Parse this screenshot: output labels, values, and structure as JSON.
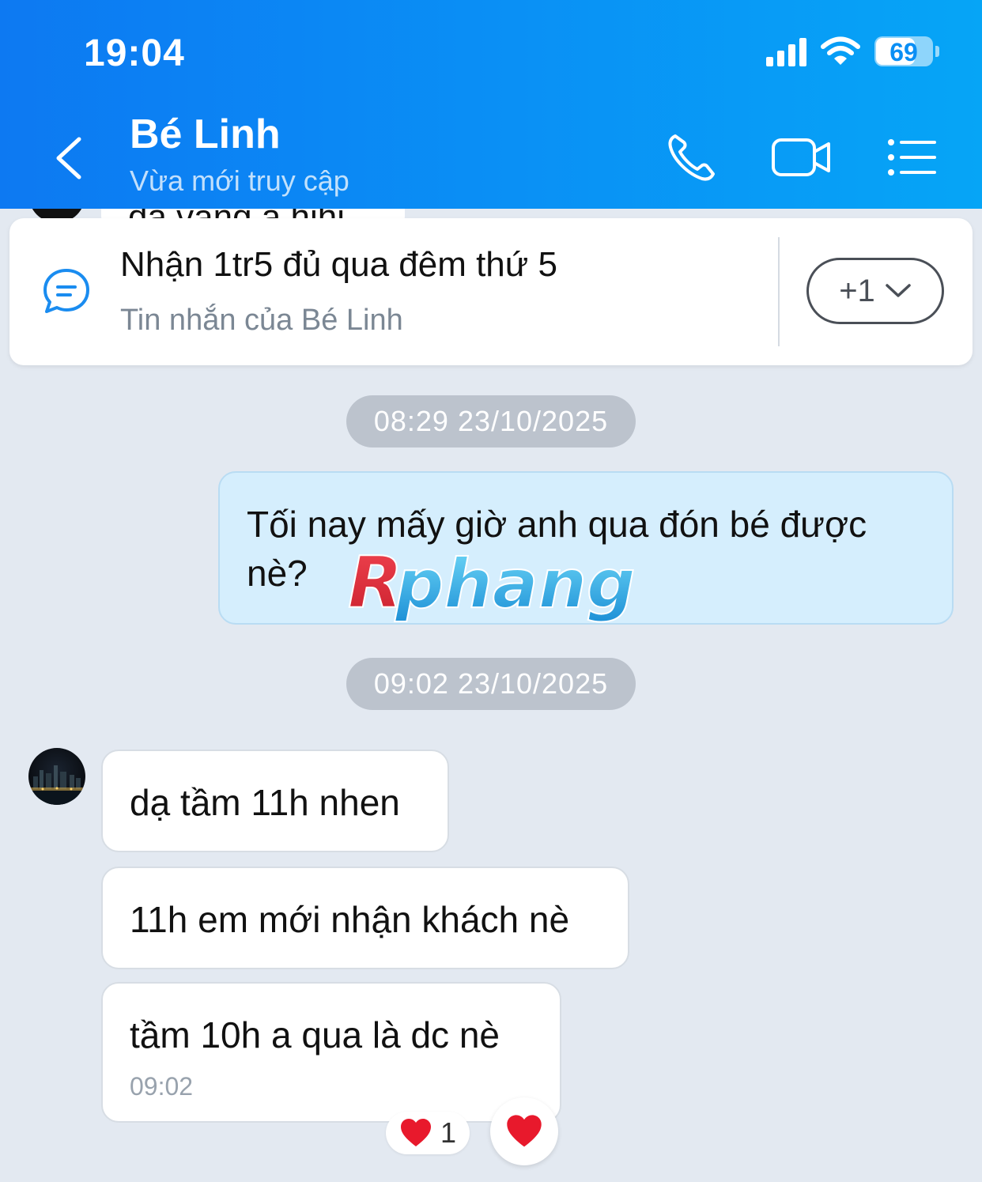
{
  "status_bar": {
    "time": "19:04",
    "battery": "69"
  },
  "header": {
    "contact_name": "Bé Linh",
    "status": "Vừa mới truy cập"
  },
  "peek_message": {
    "text": "dạ vâng a hihi"
  },
  "pinned": {
    "text": "Nhận 1tr5 đủ qua đêm thứ 5",
    "sub": "Tin nhắn của Bé Linh",
    "more": "+1"
  },
  "watermark": {
    "text": "Rphang"
  },
  "messages": [
    {
      "timestamp": "08:29 23/10/2025",
      "text": "Tối nay mấy giờ anh qua đón bé được nè?"
    },
    {
      "timestamp": "09:02 23/10/2025"
    },
    {
      "text": "dạ tầm 11h nhen"
    },
    {
      "text": "11h em mới nhận khách nè"
    },
    {
      "text": "tầm 10h a qua là dc nè",
      "time": "09:02"
    }
  ],
  "reactions": {
    "count": "1"
  },
  "colors": {
    "header_start": "#0d79f2",
    "header_end": "#06a5f6",
    "outgoing_bubble": "#d5eefd",
    "background": "#e3e9f1"
  }
}
